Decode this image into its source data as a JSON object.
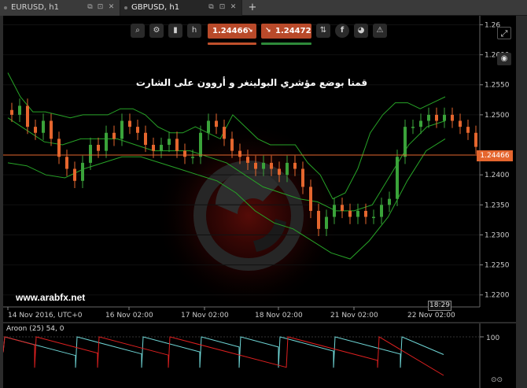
{
  "tabs": [
    {
      "label": "EURUSD, h1",
      "active": false
    },
    {
      "label": "GBPUSD, h1",
      "active": true
    }
  ],
  "add_tab_label": "+",
  "toolbar": {
    "sell_price": "1.24466",
    "buy_price": "1.24472",
    "sell_color": "#b94a2a",
    "buy_color": "#b94a2a",
    "sell_underline": "#c0502c",
    "buy_underline": "#2e8a3a"
  },
  "annotation_title": "قمنا بوضع مؤشري البولينغر و أروون على الشارت",
  "watermark": "www.arabfx.net",
  "current_price_tag": "1.24466",
  "crosshair_time": "18:29",
  "aroon_label": "Aroon (25) 54, 0",
  "icons": {
    "zoom": "zoom-in-icon",
    "settings": "chart-settings-icon",
    "candles": "candlestick-icon",
    "timeframe": "timeframe-icon",
    "trade": "trade-icon",
    "facebook": "facebook-icon",
    "objects": "drawing-icon",
    "alerts": "alert-icon",
    "camera": "camera-icon",
    "maximize": "maximize-icon"
  },
  "timeframe_label": "h",
  "colors": {
    "candle_up": "#3aa33a",
    "candle_down": "#e5662e",
    "bollinger": "#27a327",
    "price_line": "#e5662e",
    "aroon_up": "#6fd6d6",
    "aroon_down": "#e02020"
  },
  "chart_data": {
    "type": "candlestick",
    "symbol": "GBPUSD",
    "timeframe": "h1",
    "x_labels": [
      "14 Nov 2016, UTC+0",
      "16 Nov 02:00",
      "17 Nov 02:00",
      "18 Nov 02:00",
      "21 Nov 02:00",
      "22 Nov 02:00"
    ],
    "y_ticks": [
      "1.26",
      "1.2600",
      "1.2550",
      "1.2500",
      "1.2400",
      "1.2350",
      "1.2300",
      "1.2250",
      "1.2200"
    ],
    "y_tick_values": [
      1.265,
      1.26,
      1.255,
      1.25,
      1.24,
      1.235,
      1.23,
      1.225,
      1.22
    ],
    "ylim": [
      1.218,
      1.2665
    ],
    "current_price": 1.24466,
    "indicators": [
      "Bollinger Bands",
      "Aroon (25)"
    ],
    "close_series": [
      1.25,
      1.2515,
      1.248,
      1.247,
      1.249,
      1.246,
      1.243,
      1.241,
      1.239,
      1.242,
      1.245,
      1.244,
      1.247,
      1.246,
      1.249,
      1.248,
      1.247,
      1.245,
      1.244,
      1.245,
      1.246,
      1.244,
      1.243,
      1.243,
      1.247,
      1.249,
      1.248,
      1.246,
      1.244,
      1.243,
      1.242,
      1.241,
      1.242,
      1.241,
      1.24,
      1.242,
      1.241,
      1.238,
      1.234,
      1.231,
      1.233,
      1.235,
      1.234,
      1.233,
      1.234,
      1.233,
      1.233,
      1.235,
      1.236,
      1.243,
      1.248,
      1.248,
      1.249,
      1.25,
      1.249,
      1.25,
      1.249,
      1.248,
      1.247,
      1.24466
    ],
    "bollinger_upper": [
      1.257,
      1.253,
      1.2505,
      1.2505,
      1.25,
      1.2495,
      1.25,
      1.25,
      1.25,
      1.251,
      1.251,
      1.25,
      1.248,
      1.247,
      1.247,
      1.248,
      1.247,
      1.246,
      1.25,
      1.248,
      1.246,
      1.245,
      1.245,
      1.245,
      1.242,
      1.24,
      1.236,
      1.237,
      1.241,
      1.247,
      1.25,
      1.252,
      1.252,
      1.251,
      1.252,
      1.253
    ],
    "bollinger_middle": [
      1.2495,
      1.2475,
      1.2455,
      1.245,
      1.246,
      1.246,
      1.246,
      1.245,
      1.244,
      1.244,
      1.244,
      1.243,
      1.242,
      1.24,
      1.238,
      1.237,
      1.236,
      1.2355,
      1.234,
      1.234,
      1.235,
      1.24,
      1.245,
      1.248,
      1.249
    ],
    "bollinger_lower": [
      1.242,
      1.2415,
      1.24,
      1.2395,
      1.241,
      1.242,
      1.243,
      1.243,
      1.242,
      1.241,
      1.24,
      1.239,
      1.237,
      1.234,
      1.232,
      1.231,
      1.229,
      1.227,
      1.226,
      1.229,
      1.233,
      1.239,
      1.244,
      1.246
    ],
    "aroon": {
      "range": [
        0,
        100
      ],
      "tick": "100",
      "aroon_up_last": 54,
      "aroon_down_last": 0
    }
  }
}
